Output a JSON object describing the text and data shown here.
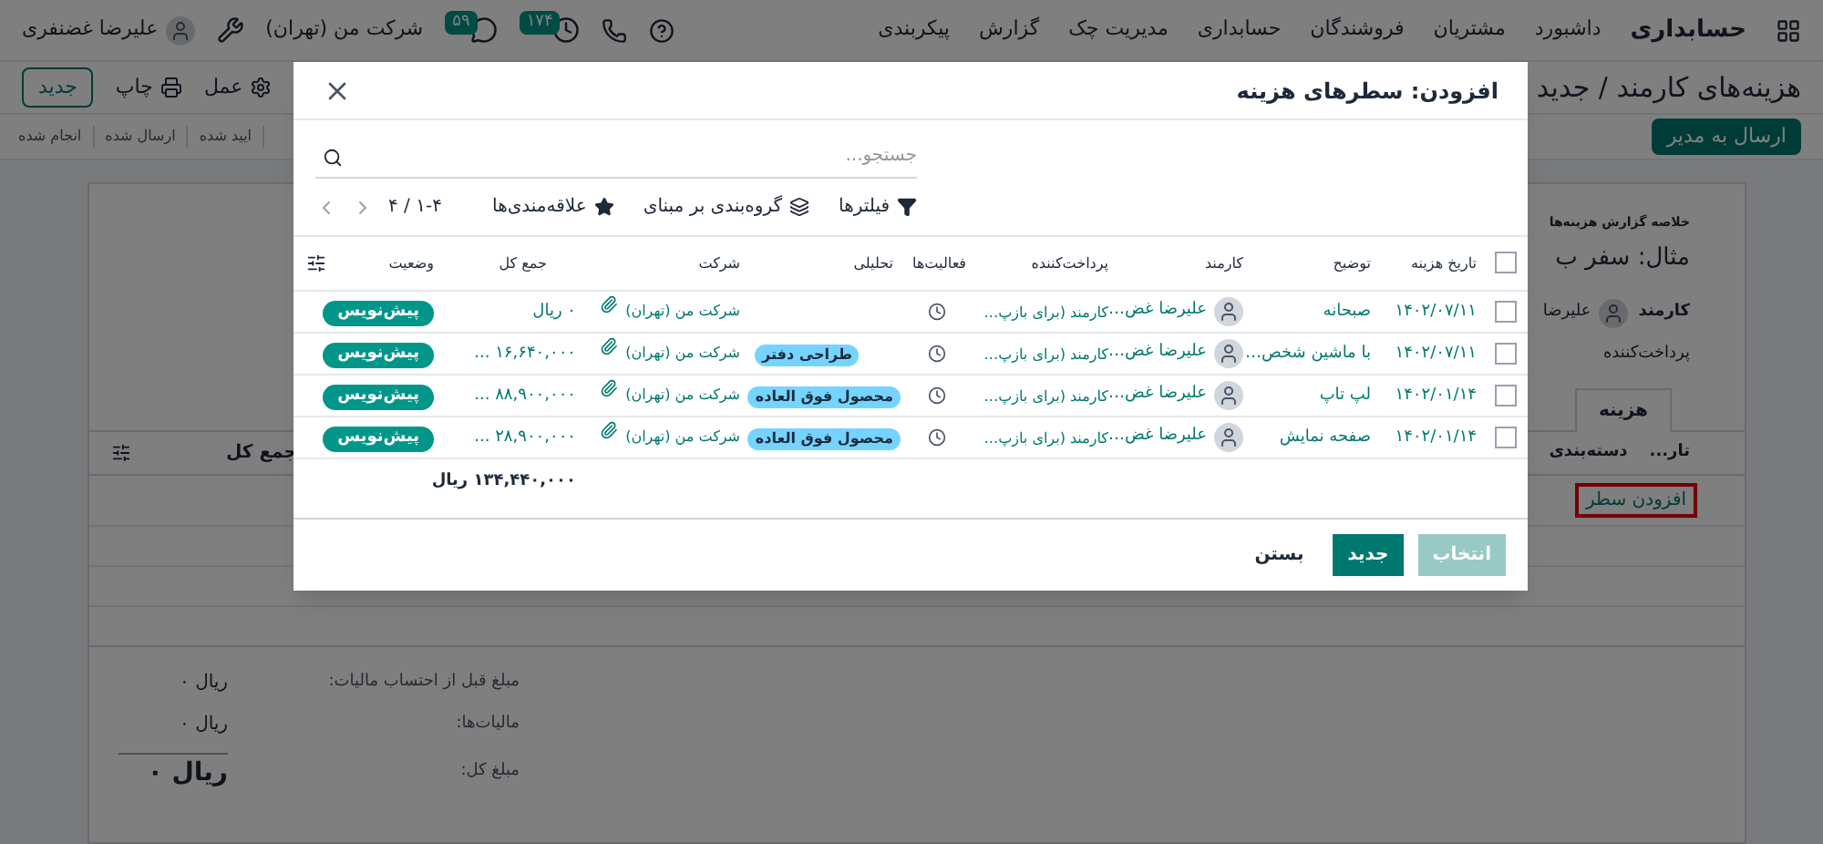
{
  "nav": {
    "app": "حسابداری",
    "menu": [
      "داشبورد",
      "مشتریان",
      "فروشندگان",
      "حسابداری",
      "مدیریت چک",
      "گزارش",
      "پیکربندی"
    ],
    "badges": [
      {
        "kind": "activities",
        "count": "۱۷۴"
      },
      {
        "kind": "messages",
        "count": "۵۹"
      }
    ],
    "company": "شرکت من (تهران)",
    "user": "علیرضا غضنفری"
  },
  "control_panel": {
    "breadcrumb": "هزینه‌های کارمند / جدید",
    "buttons": [
      {
        "kind": "action",
        "label": "عمل"
      },
      {
        "kind": "print",
        "label": "چاپ"
      },
      {
        "kind": "new",
        "label": "جدید"
      }
    ]
  },
  "status_bar": {
    "action": "ارسال به مدیر",
    "stages": [
      "ایید شده",
      "ارسال شده",
      "انجام شده"
    ]
  },
  "form": {
    "subtitle": "خلاصه گزارش هزینه‌ها",
    "title": "مثال: سفر ب",
    "fields": [
      {
        "label": "کارمند",
        "value": "علیرضا"
      },
      {
        "label": "پرداخت‌کننده"
      }
    ],
    "tabs": [
      {
        "label": "هزینه",
        "selected": true
      }
    ],
    "columns": [
      "تار...",
      "دسته‌بندی",
      "جمع کل"
    ],
    "add_line": "افزودن سطر",
    "totals": [
      {
        "label": "مبلغ قبل از احتساب مالیات:",
        "value": "ریال ۰"
      },
      {
        "label": "مالیات‌ها:",
        "value": "ریال ۰"
      },
      {
        "label": "مبلغ کل:",
        "value": "ریال ۰"
      }
    ]
  },
  "dialog": {
    "title": "افزودن: سطرهای هزینه",
    "search": {
      "placeholder": "جستجو..."
    },
    "toolbar": [
      {
        "kind": "filters",
        "label": "فیلترها"
      },
      {
        "kind": "group_by",
        "label": "گروه‌بندی بر مبنای"
      },
      {
        "kind": "favorites",
        "label": "علاقه‌مندی‌ها"
      }
    ],
    "pager": "۱-۴ / ۴",
    "all_checked": false,
    "columns": [
      "تاریخ هزینه",
      "توضیح",
      "کارمند",
      "پرداخت‌کننده",
      "فعالیت‌ها",
      "تحلیلی",
      "شرکت",
      "جمع کل",
      "وضعیت"
    ],
    "rows": [
      {
        "checked": false,
        "date": "۱۴۰۲/۰۷/۱۱",
        "description": "صبحانه",
        "employee": "علیرضا غض…",
        "paid_by": "کارمند (برای بازپ…",
        "company": "شرکت من (تهران)",
        "total": "۰ ریال",
        "status": "پیش‌نویس"
      },
      {
        "checked": false,
        "date": "۱۴۰۲/۰۷/۱۱",
        "description": "با ماشین شخص…",
        "employee": "علیرضا غض…",
        "paid_by": "کارمند (برای بازپ…",
        "analytic": "طراحی دفتر",
        "company": "شرکت من (تهران)",
        "total": "۱۶,۶۴۰,۰۰۰ ...",
        "status": "پیش‌نویس"
      },
      {
        "checked": false,
        "date": "۱۴۰۲/۰۱/۱۴",
        "description": "لپ تاپ",
        "employee": "علیرضا غض…",
        "paid_by": "کارمند (برای بازپ…",
        "analytic": "محصول فوق العاده",
        "company": "شرکت من (تهران)",
        "total": "۸۸,۹۰۰,۰۰۰ ...",
        "status": "پیش‌نویس"
      },
      {
        "checked": false,
        "date": "۱۴۰۲/۰۱/۱۴",
        "description": "صفحه نمایش",
        "employee": "علیرضا غض…",
        "paid_by": "کارمند (برای بازپ…",
        "analytic": "محصول فوق العاده",
        "company": "شرکت من (تهران)",
        "total": "۲۸,۹۰۰,۰۰۰ ...",
        "status": "پیش‌نویس"
      }
    ],
    "footer_total": "۱۳۴,۴۴۰,۰۰۰ ریال",
    "buttons": [
      {
        "kind": "select",
        "label": "انتخاب",
        "disabled": true
      },
      {
        "kind": "new",
        "label": "جدید",
        "disabled": false
      },
      {
        "kind": "close",
        "label": "بستن",
        "disabled": false
      }
    ]
  }
}
